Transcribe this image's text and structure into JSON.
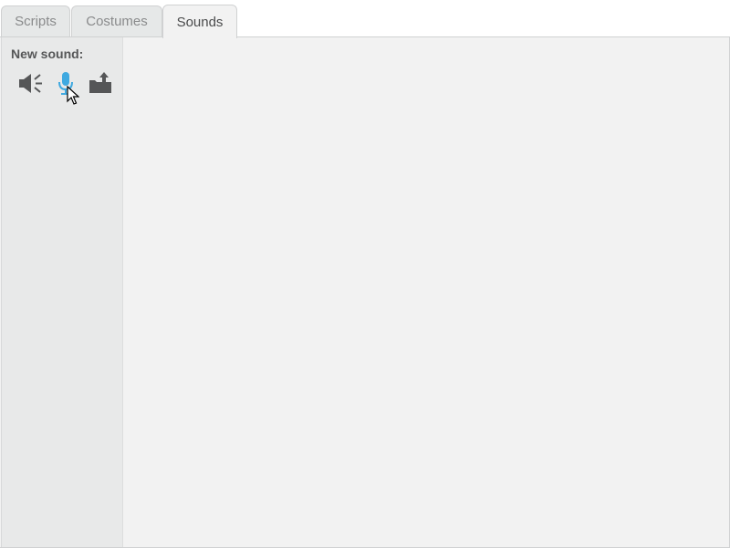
{
  "tabs": [
    {
      "label": "Scripts",
      "active": false
    },
    {
      "label": "Costumes",
      "active": false
    },
    {
      "label": "Sounds",
      "active": true
    }
  ],
  "sidebar": {
    "new_sound_label": "New sound:",
    "buttons": [
      {
        "name": "choose-sound-from-library",
        "icon": "speaker-icon",
        "color": "#555657"
      },
      {
        "name": "record-new-sound",
        "icon": "microphone-icon",
        "color": "#3fa9e0"
      },
      {
        "name": "upload-sound-from-file",
        "icon": "upload-icon",
        "color": "#555657"
      }
    ]
  },
  "colors": {
    "accent": "#3fa9e0",
    "panel_bg": "#f2f2f2",
    "sidebar_bg": "#e8e9e9",
    "icon_gray": "#555657"
  }
}
